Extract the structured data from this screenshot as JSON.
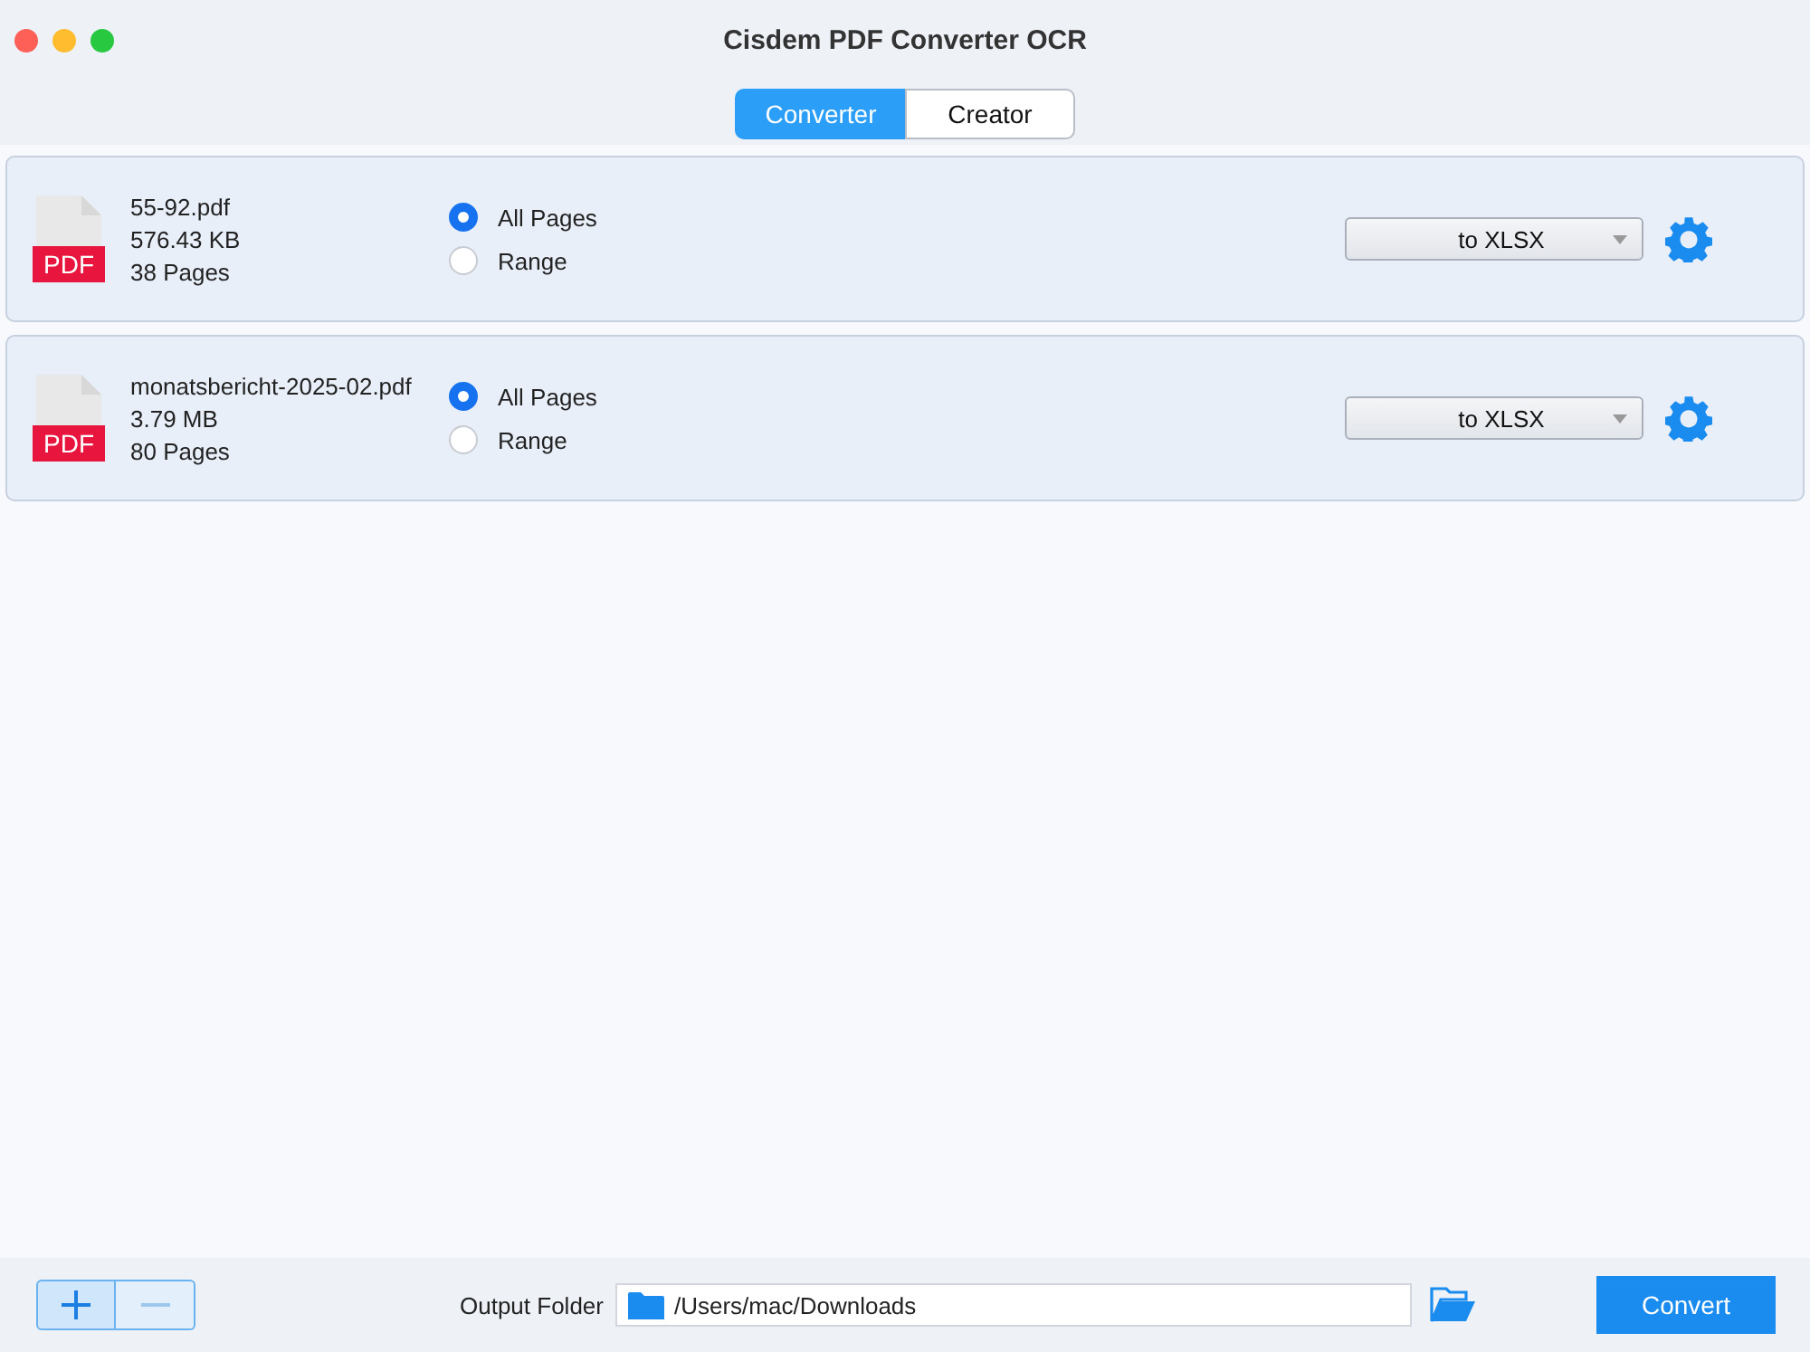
{
  "window": {
    "title": "Cisdem PDF Converter OCR"
  },
  "tabs": [
    {
      "label": "Converter",
      "selected": true
    },
    {
      "label": "Creator",
      "selected": false
    }
  ],
  "files": [
    {
      "icon_label": "PDF",
      "name": "55-92.pdf",
      "size": "576.43 KB",
      "pages": "38 Pages",
      "options": [
        {
          "label": "All Pages",
          "selected": true
        },
        {
          "label": "Range",
          "selected": false
        }
      ],
      "format": "to XLSX"
    },
    {
      "icon_label": "PDF",
      "name": "monatsbericht-2025-02.pdf",
      "size": "3.79 MB",
      "pages": "80 Pages",
      "options": [
        {
          "label": "All Pages",
          "selected": true
        },
        {
          "label": "Range",
          "selected": false
        }
      ],
      "format": "to XLSX"
    }
  ],
  "footer": {
    "buttons": [
      {
        "kind": "add",
        "disabled": false
      },
      {
        "kind": "remove",
        "disabled": true
      }
    ],
    "output_label": "Output Folder",
    "output_path": "/Users/mac/Downloads",
    "convert": "Convert"
  }
}
